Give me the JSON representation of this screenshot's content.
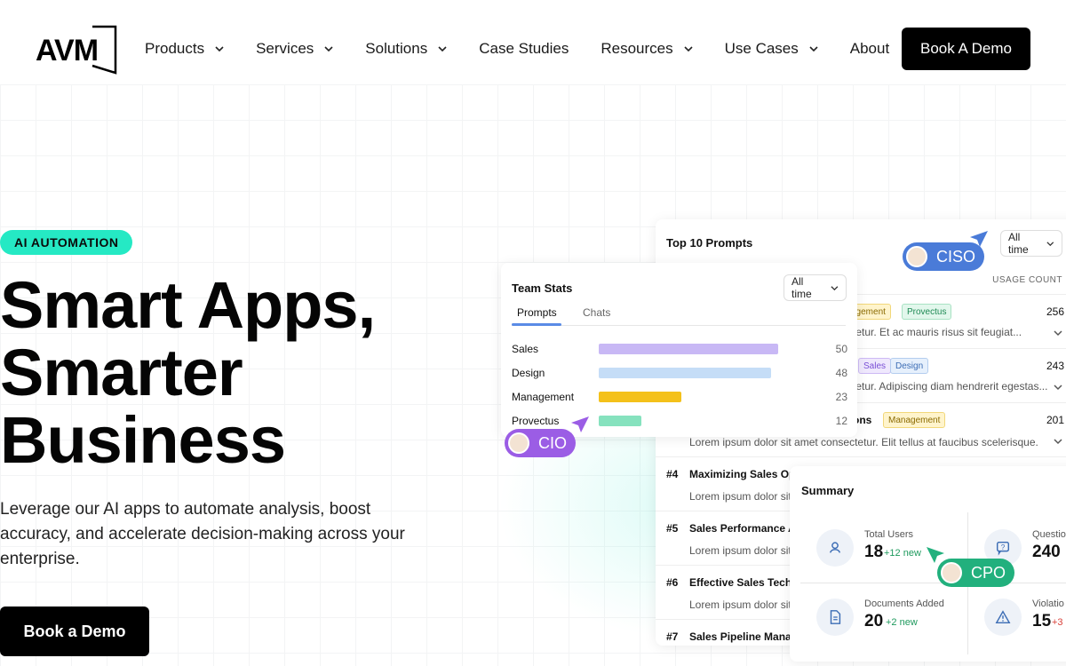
{
  "header": {
    "logo_text": "AVM",
    "nav": [
      {
        "label": "Products",
        "dropdown": true
      },
      {
        "label": "Services",
        "dropdown": true
      },
      {
        "label": "Solutions",
        "dropdown": true
      },
      {
        "label": "Case Studies",
        "dropdown": false
      },
      {
        "label": "Resources",
        "dropdown": true
      },
      {
        "label": "Use Cases",
        "dropdown": true
      },
      {
        "label": "About",
        "dropdown": false
      }
    ],
    "cta": "Book A Demo"
  },
  "hero": {
    "badge": "AI AUTOMATION",
    "headline_1": "Smart Apps,",
    "headline_2": "Smarter",
    "headline_3": "Business",
    "subtext": "Leverage our AI apps to automate analysis, boost accuracy, and accelerate decision-making across your enterprise.",
    "cta": "Book a Demo",
    "badge_color": "#25e9c4"
  },
  "top_prompts": {
    "title": "Top 10 Prompts",
    "filter": "All time",
    "column_header": "USAGE COUNT",
    "rows": [
      {
        "rank": "",
        "name": "",
        "tags": [
          "agement",
          "Provectus"
        ],
        "desc": "tetur. Et ac mauris risus sit feugiat...",
        "count": "256"
      },
      {
        "rank": "",
        "name": "",
        "tags": [
          "Sales",
          "Design"
        ],
        "desc": "tetur. Adipiscing diam hendrerit egestas...",
        "count": "243"
      },
      {
        "rank": "",
        "name": "ons",
        "tags": [
          "Management"
        ],
        "desc": "Lorem ipsum dolor sit amet consectetur. Elit tellus at faucibus scelerisque.",
        "count": "201"
      },
      {
        "rank": "#4",
        "name": "Maximizing Sales Opp",
        "tags": [],
        "desc": "Lorem ipsum dolor sit",
        "count": ""
      },
      {
        "rank": "#5",
        "name": "Sales Performance An",
        "tags": [],
        "desc": "Lorem ipsum dolor sit",
        "count": ""
      },
      {
        "rank": "#6",
        "name": "Effective Sales Techni",
        "tags": [],
        "desc": "Lorem ipsum dolor sit",
        "count": ""
      },
      {
        "rank": "#7",
        "name": "Sales Pipeline Manag",
        "tags": [],
        "desc": "",
        "count": ""
      }
    ]
  },
  "team_stats": {
    "title": "Team Stats",
    "filter": "All time",
    "tabs": [
      "Prompts",
      "Chats"
    ],
    "active_tab": "Prompts",
    "bars": [
      {
        "label": "Sales",
        "value": 50,
        "color": "#c8b8f5"
      },
      {
        "label": "Design",
        "value": 48,
        "color": "#c5ddf7"
      },
      {
        "label": "Management",
        "value": 23,
        "color": "#f4c11a"
      },
      {
        "label": "Provectus",
        "value": 12,
        "color": "#86e2be"
      }
    ]
  },
  "summary": {
    "title": "Summary",
    "metrics": [
      {
        "label": "Total Users",
        "value": "18",
        "delta": "+12 new",
        "icon": "user-icon"
      },
      {
        "label": "Questio",
        "value": "240",
        "delta": "",
        "icon": "question-icon"
      },
      {
        "label": "Documents Added",
        "value": "20",
        "delta": "+2 new",
        "icon": "document-icon"
      },
      {
        "label": "Violatio",
        "value": "15",
        "delta": "+3",
        "icon": "warning-icon"
      }
    ]
  },
  "cursors": [
    {
      "label": "CISO",
      "color": "#4a7bd8"
    },
    {
      "label": "CIO",
      "color": "#9b5de5"
    },
    {
      "label": "CPO",
      "color": "#22b07d"
    }
  ]
}
